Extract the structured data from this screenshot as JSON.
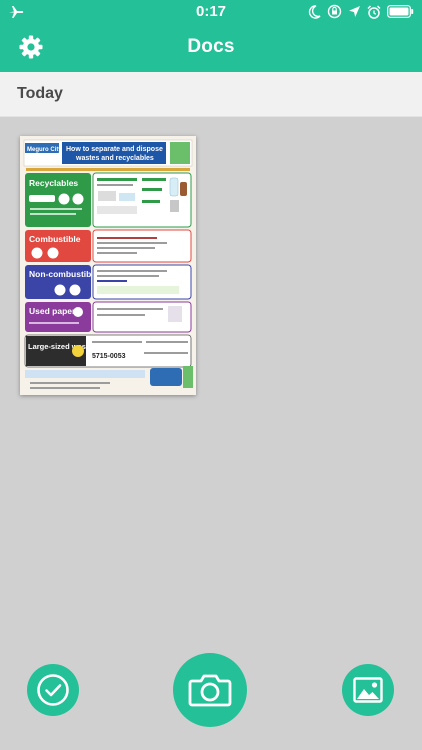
{
  "status_bar": {
    "time": "0:17",
    "icons": [
      "airplane-icon",
      "moon-icon",
      "orientation-lock-icon",
      "location-icon",
      "alarm-icon",
      "battery-icon"
    ]
  },
  "nav": {
    "title": "Docs",
    "left_icon": "gear-icon"
  },
  "section": {
    "header": "Today"
  },
  "documents": [
    {
      "thumbnail_text": {
        "city": "Meguro City",
        "title_line1": "How to separate and dispose",
        "title_line2": "wastes and recyclables",
        "categories": [
          "Recyclables",
          "Combustible",
          "Non-combustible",
          "Used paper",
          "Large-sized wastes"
        ],
        "phone": "5715-0053"
      }
    }
  ],
  "toolbar": {
    "select_icon": "check-circle-icon",
    "camera_icon": "camera-icon",
    "gallery_icon": "image-icon"
  },
  "colors": {
    "accent": "#24c097",
    "background": "#d0d0d0",
    "section_bg": "#f1f1f1"
  }
}
